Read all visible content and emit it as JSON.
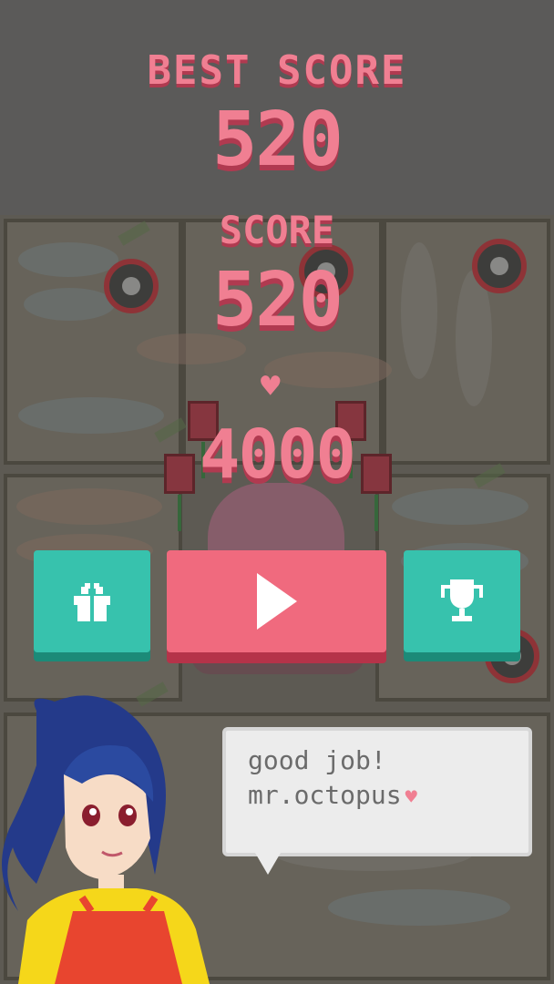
{
  "best_score": {
    "label": "BEST SCORE",
    "value": "520"
  },
  "score": {
    "label": "SCORE",
    "value": "520"
  },
  "hearts": {
    "icon": "heart-icon",
    "value": "4000"
  },
  "buttons": {
    "gift": {
      "icon": "gift-icon"
    },
    "play": {
      "icon": "play-icon"
    },
    "trophy": {
      "icon": "trophy-icon"
    }
  },
  "speech": {
    "line1": "good job!",
    "line2": "mr.octopus",
    "line2_icon": "♥"
  },
  "colors": {
    "accent_pink": "#f07f92",
    "teal": "#37c2ad",
    "play_red": "#f06a7e"
  }
}
